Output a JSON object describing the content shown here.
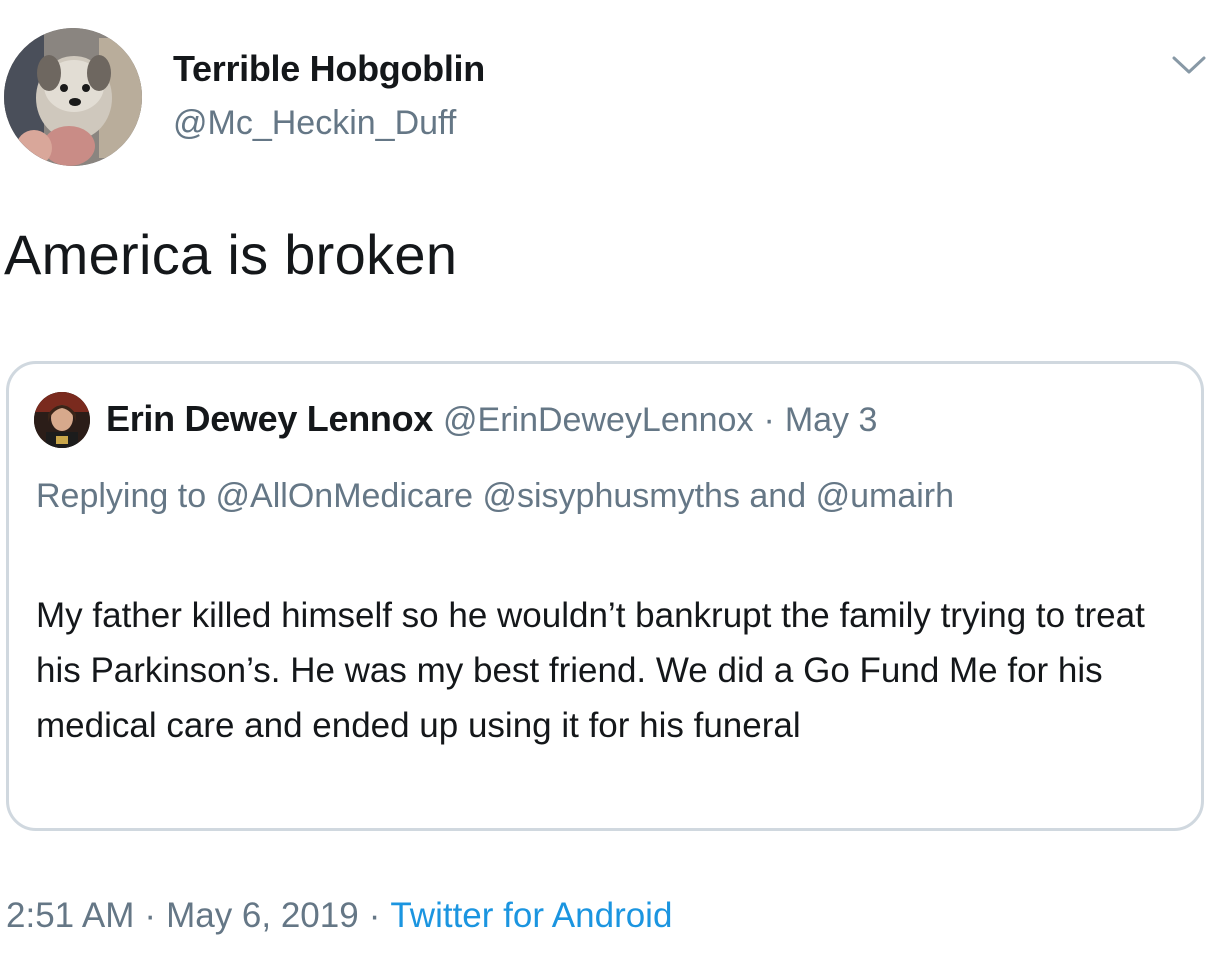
{
  "tweet": {
    "author_name": "Terrible Hobgoblin",
    "author_handle": "@Mc_Heckin_Duff",
    "text": "America is broken",
    "time": "2:51 AM",
    "separator": "·",
    "date": "May 6, 2019",
    "source": "Twitter for Android"
  },
  "quoted_tweet": {
    "author_name": "Erin Dewey Lennox",
    "author_handle": "@ErinDeweyLennox",
    "separator": "·",
    "date": "May 3",
    "replying_to": "Replying to @AllOnMedicare @sisyphusmyths and @umairh",
    "text": "My father killed himself so he wouldn’t bankrupt the family trying to treat his Parkinson’s. He was my best friend. We did a Go Fund Me for his medical care and ended up using it for his funeral"
  },
  "colors": {
    "primary_text": "#14171a",
    "secondary_text": "#657786",
    "link": "#1b95e0",
    "border": "#d0d8df"
  },
  "icons": {
    "menu_caret": "chevron-down-icon"
  }
}
